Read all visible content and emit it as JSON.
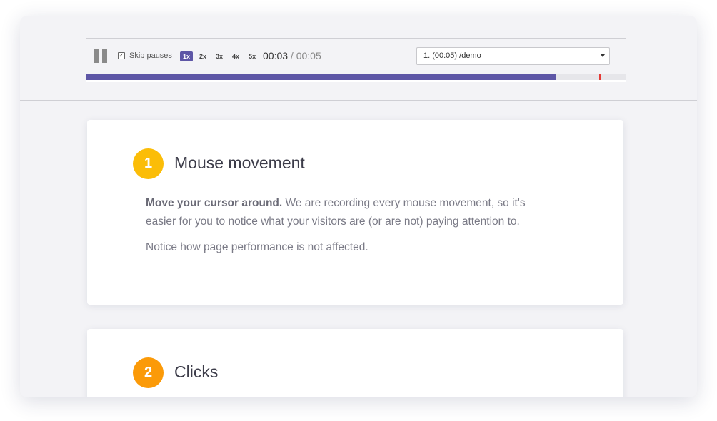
{
  "player": {
    "skip_pauses_label": "Skip pauses",
    "skip_pauses_checked": true,
    "speeds": [
      "1x",
      "2x",
      "3x",
      "4x",
      "5x"
    ],
    "active_speed": "1x",
    "current_time": "00:03",
    "time_separator": " / ",
    "total_time": "00:05",
    "page_selected": "1. (00:05) /demo",
    "progress_fraction": 0.87,
    "marker_fraction": 0.95,
    "colors": {
      "accent": "#5d56a6",
      "marker": "#e53935"
    }
  },
  "steps": [
    {
      "number": "1",
      "title": "Mouse movement",
      "body_bold": "Move your cursor around.",
      "body_rest": " We are recording every mouse movement, so it's easier for you to notice what your visitors are (or are not) paying attention to.",
      "body_2": "Notice how page performance is not affected.",
      "badge_color": "#fbbd08"
    },
    {
      "number": "2",
      "title": "Clicks",
      "badge_color": "#fb9a08"
    }
  ]
}
